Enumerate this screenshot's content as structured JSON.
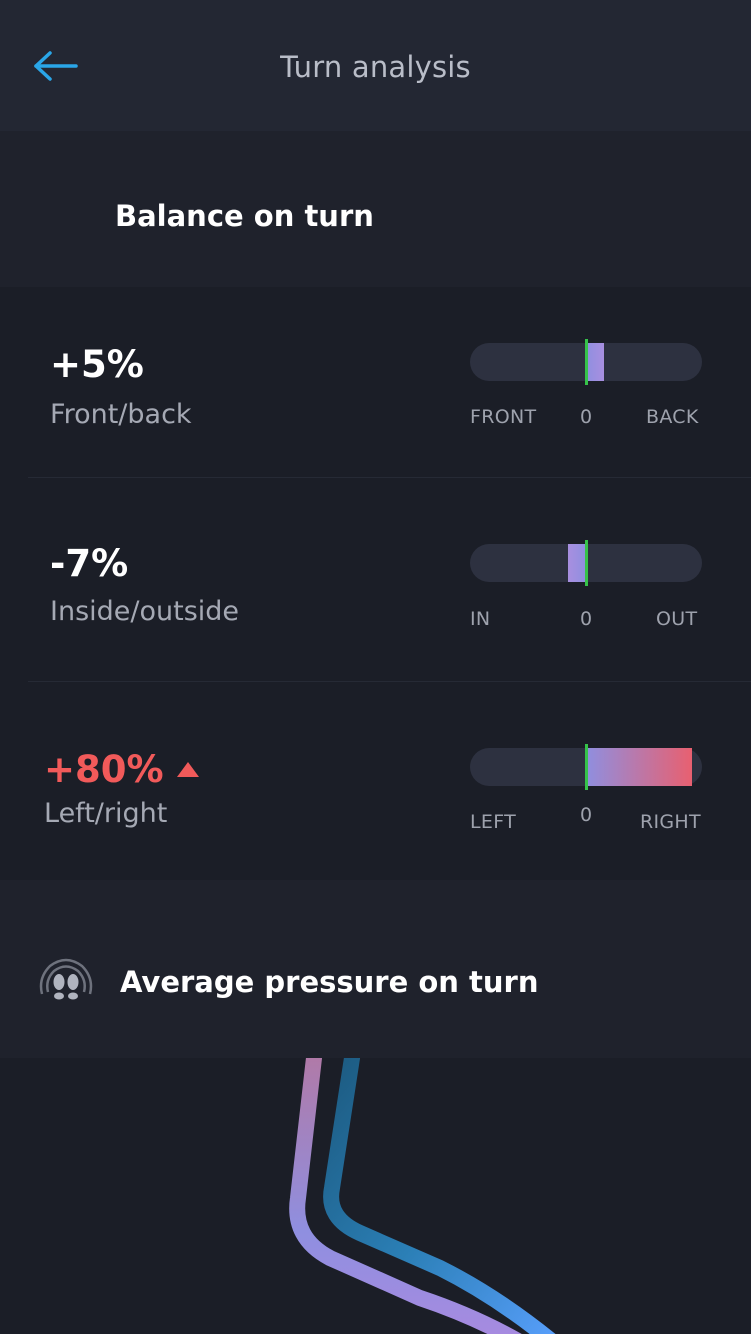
{
  "header": {
    "title": "Turn analysis"
  },
  "balance_section": {
    "title": "Balance on turn",
    "icon": "footprints-icon"
  },
  "metrics": [
    {
      "value": "+5%",
      "label": "Front/back",
      "left_scale": "FRONT",
      "zero_label": "0",
      "right_scale": "BACK",
      "balance_percent": 5
    },
    {
      "value": "-7%",
      "label": "Inside/outside",
      "left_scale": "IN",
      "zero_label": "0",
      "right_scale": "OUT",
      "balance_percent": -7
    },
    {
      "value": "+80%",
      "label": "Left/right",
      "left_scale": "LEFT",
      "zero_label": "0",
      "right_scale": "RIGHT",
      "balance_percent": 80,
      "alert": true
    }
  ],
  "pressure_section": {
    "title": "Average pressure on turn",
    "icon": "pressure-footprints-icon"
  },
  "colors": {
    "accent_back": "#2aa6e8",
    "zero_marker": "#36c24a",
    "alert": "#f15a5a",
    "fill_start": "#8f8fe0",
    "fill_end": "#e86070"
  }
}
